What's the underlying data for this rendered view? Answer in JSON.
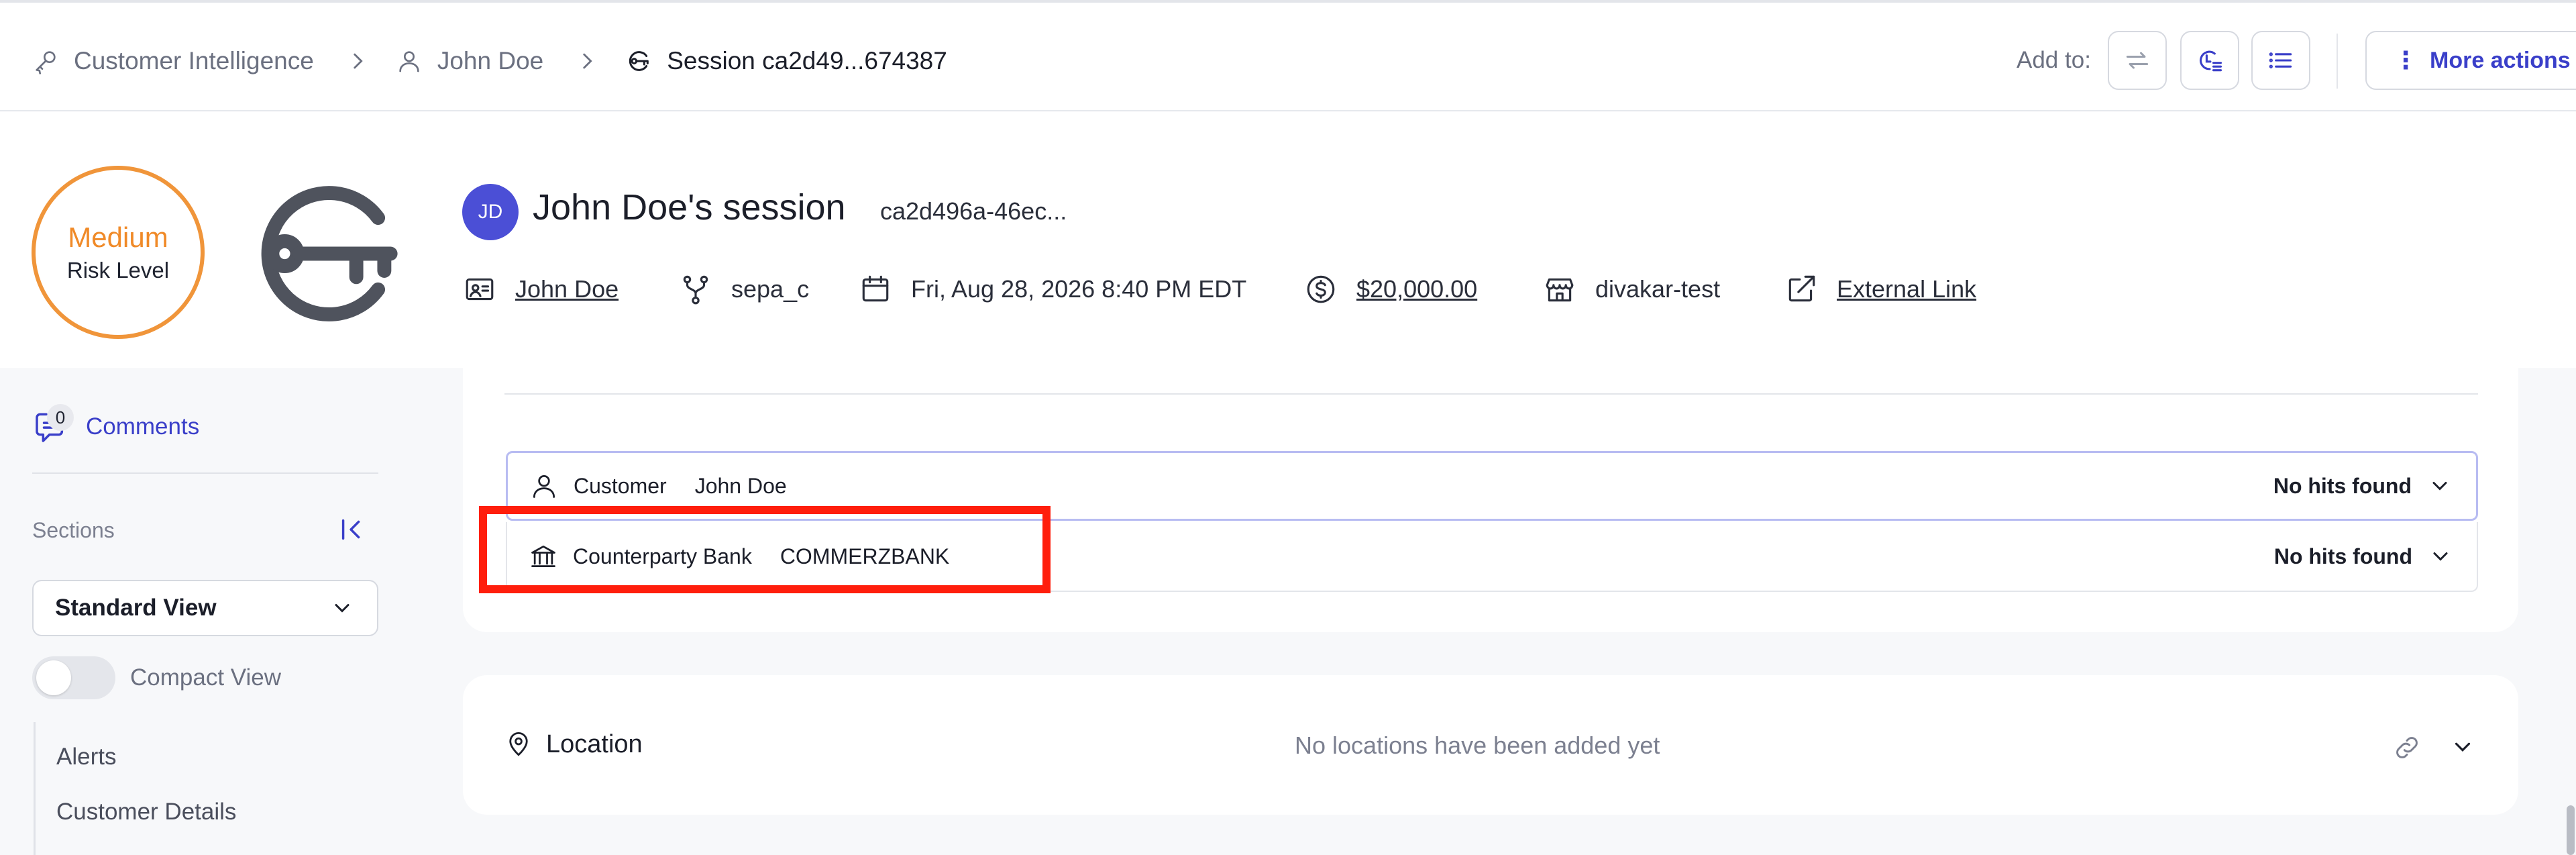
{
  "breadcrumb": {
    "items": [
      {
        "label": "Customer Intelligence",
        "icon": "key-icon"
      },
      {
        "label": "John Doe",
        "icon": "user-icon"
      },
      {
        "label": "Session ca2d49...674387",
        "icon": "session-key-icon"
      }
    ]
  },
  "toolbar": {
    "add_to_label": "Add to:",
    "icons": [
      "workflow-icon",
      "case-report-icon",
      "list-icon"
    ],
    "more_actions_label": "More actions",
    "more_actions_icon": "vertical-dots-icon"
  },
  "header": {
    "risk": {
      "level": "Medium",
      "label": "Risk Level",
      "color": "#f0953a"
    },
    "avatar_initials": "JD",
    "avatar_color": "#4b4fd6",
    "title": "John Doe's session",
    "session_id": "ca2d496a-46ec...",
    "meta": {
      "customer": "John Doe",
      "rail": "sepa_c",
      "datetime": "Fri, Aug 28, 2026 8:40 PM EDT",
      "amount": "$20,000.00",
      "merchant": "divakar-test",
      "external_link": "External Link"
    }
  },
  "sidebar": {
    "comments_label": "Comments",
    "comments_count": "0",
    "sections_label": "Sections",
    "view_select": "Standard View",
    "compact_view_label": "Compact View",
    "compact_view_enabled": false,
    "nav": [
      "Alerts",
      "Customer Details"
    ]
  },
  "screening": {
    "rows": [
      {
        "type": "Customer",
        "value": "John Doe",
        "status": "No hits found",
        "icon": "user-icon"
      },
      {
        "type": "Counterparty Bank",
        "value": "COMMERZBANK",
        "status": "No hits found",
        "icon": "bank-icon"
      }
    ],
    "highlight_color": "#ff1e0c"
  },
  "location": {
    "title": "Location",
    "empty_text": "No locations have been added yet"
  },
  "colors": {
    "accent": "#3a3fc9",
    "risk_medium": "#f0953a",
    "selected_border": "#b8bcf2"
  }
}
